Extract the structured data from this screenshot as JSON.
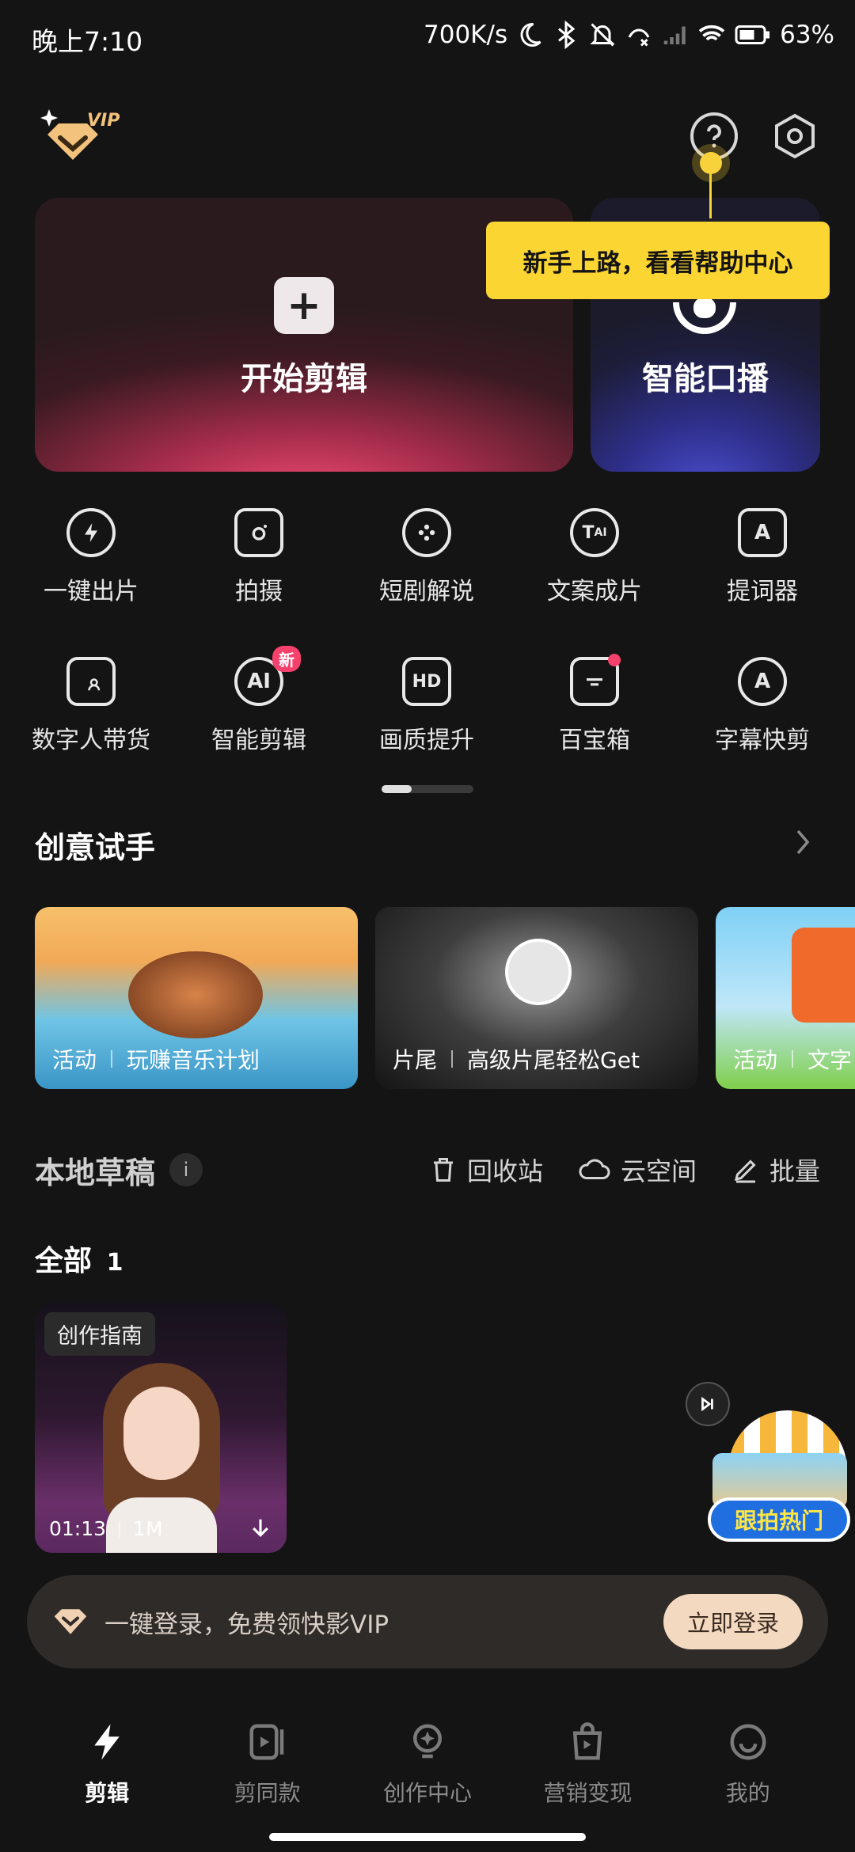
{
  "status_bar": {
    "time": "晚上7:10",
    "net_speed": "700K/s",
    "battery": "63%"
  },
  "header": {
    "vip_badge": "VIP",
    "help_icon": "question-circle-icon",
    "settings_icon": "hexagon-settings-icon"
  },
  "cards": {
    "start_edit": "开始剪辑",
    "smart_voice": "智能口播"
  },
  "tooltip": {
    "text": "新手上路，看看帮助中心"
  },
  "tools_row1": [
    {
      "label": "一键出片",
      "icon": "bolt-icon"
    },
    {
      "label": "拍摄",
      "icon": "camera-icon"
    },
    {
      "label": "短剧解说",
      "icon": "film-reel-icon"
    },
    {
      "label": "文案成片",
      "icon": "text-ai-icon"
    },
    {
      "label": "提词器",
      "icon": "teleprompter-icon"
    }
  ],
  "tools_row2": [
    {
      "label": "数字人带货",
      "icon": "digital-human-icon"
    },
    {
      "label": "智能剪辑",
      "icon": "ai-icon",
      "badge": "新"
    },
    {
      "label": "画质提升",
      "icon": "hd-icon"
    },
    {
      "label": "百宝箱",
      "icon": "toolbox-icon"
    },
    {
      "label": "字幕快剪",
      "icon": "subtitle-icon"
    }
  ],
  "creative": {
    "title": "创意试手",
    "banners": [
      {
        "tag": "活动",
        "text": "玩赚音乐计划"
      },
      {
        "tag": "片尾",
        "text": "高级片尾轻松Get"
      },
      {
        "tag": "活动",
        "text": "文字"
      }
    ]
  },
  "drafts": {
    "title": "本地草稿",
    "info": "i",
    "recycle": "回收站",
    "cloud": "云空间",
    "batch": "批量",
    "filter_label": "全部",
    "count": "1",
    "item": {
      "tag": "创作指南",
      "duration": "01:13",
      "size": "1M"
    }
  },
  "float_promo": {
    "label": "跟拍热门"
  },
  "login_bar": {
    "text": "一键登录，免费领快影VIP",
    "button": "立即登录"
  },
  "bottom_nav": [
    {
      "label": "剪辑",
      "active": true
    },
    {
      "label": "剪同款"
    },
    {
      "label": "创作中心"
    },
    {
      "label": "营销变现"
    },
    {
      "label": "我的"
    }
  ],
  "colors": {
    "background": "#141414",
    "tooltip": "#fbd532",
    "accent_red": "#f5416b"
  }
}
